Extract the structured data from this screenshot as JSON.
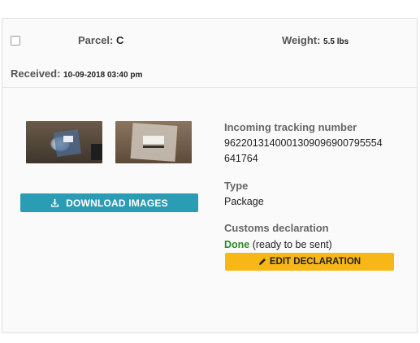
{
  "header": {
    "parcel_label": "Parcel:",
    "parcel_value": "C",
    "weight_label": "Weight:",
    "weight_value": "5.5 lbs",
    "received_label": "Received:",
    "received_value": "10-09-2018 03:40 pm"
  },
  "images": {
    "download_label": "DOWNLOAD IMAGES",
    "icons": {
      "download": "download-icon"
    }
  },
  "details": {
    "tracking_label": "Incoming tracking number",
    "tracking_value_line1": "9622013140001309096900795554",
    "tracking_value_line2": "641764",
    "type_label": "Type",
    "type_value": "Package",
    "customs_label": "Customs declaration",
    "customs_status": "Done",
    "customs_note": "(ready to be sent)",
    "edit_label": "EDIT DECLARATION",
    "icons": {
      "edit": "pencil-icon"
    }
  },
  "colors": {
    "download_button": "#2a9cb4",
    "edit_button": "#f7b717",
    "done_status": "#2c8a2c"
  }
}
